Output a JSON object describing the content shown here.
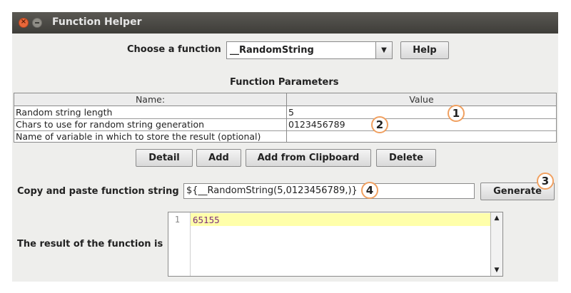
{
  "window": {
    "title": "Function Helper"
  },
  "function_chooser": {
    "label": "Choose a function",
    "selected": "__RandomString",
    "help_label": "Help"
  },
  "parameters": {
    "heading": "Function Parameters",
    "columns": [
      "Name:",
      "Value"
    ],
    "rows": [
      {
        "name": "Random string length",
        "value": "5"
      },
      {
        "name": "Chars to use for random string generation",
        "value": "0123456789"
      },
      {
        "name": "Name of variable in which to store the result (optional)",
        "value": ""
      }
    ]
  },
  "actions": {
    "detail": "Detail",
    "add": "Add",
    "add_clipboard": "Add from Clipboard",
    "delete": "Delete"
  },
  "function_string": {
    "label": "Copy and paste function string",
    "value": "${__RandomString(5,0123456789,)}",
    "generate_label": "Generate"
  },
  "result": {
    "label": "The result of the function is",
    "line_number": "1",
    "value": "65155"
  },
  "annotations": [
    "1",
    "2",
    "3",
    "4"
  ],
  "colors": {
    "titlebar": "#3e3d39",
    "highlight": "#ffffaa",
    "annotation_ring": "#f0a060",
    "close_button": "#e8673a"
  }
}
